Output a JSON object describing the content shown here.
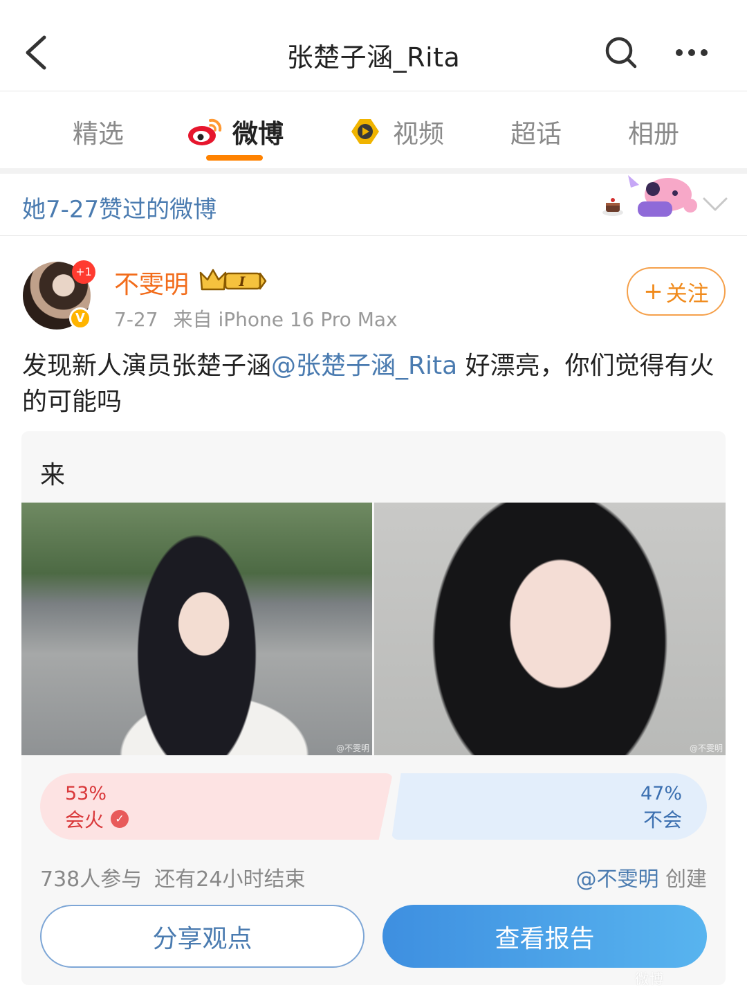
{
  "header": {
    "title": "张楚子涵_Rita",
    "back_icon": "chevron-left-icon",
    "search_icon": "search-icon",
    "more_icon": "more-dots-icon"
  },
  "tabs": [
    {
      "label": "精选",
      "active": false
    },
    {
      "label": "微博",
      "active": true,
      "icon": "weibo-logo-icon"
    },
    {
      "label": "视频",
      "active": false,
      "icon": "video-play-icon"
    },
    {
      "label": "超话",
      "active": false
    },
    {
      "label": "相册",
      "active": false
    }
  ],
  "accent_color": "#ff8200",
  "liked_banner": {
    "text": "她7-27赞过的微博",
    "expand_icon": "chevron-down-icon"
  },
  "post": {
    "author": {
      "name": "不雯明",
      "notification_badge": "+1",
      "verified_badge": "V",
      "level_badge": "I"
    },
    "date": "7-27",
    "source": "来自 iPhone 16 Pro Max",
    "follow_label": "关注",
    "follow_plus": "+",
    "text_before": "发现新人演员张楚子涵",
    "mention": "@张楚子涵_Rita",
    "text_after": " 好漂亮，你们觉得有火的可能吗"
  },
  "poll": {
    "title": "来",
    "photo_watermark_left": "@不雯明",
    "photo_watermark_right": "@不雯明",
    "options": [
      {
        "percent": "53%",
        "label": "会火",
        "selected": true,
        "fraction": 0.53,
        "color": "#d9383a"
      },
      {
        "percent": "47%",
        "label": "不会",
        "selected": false,
        "fraction": 0.47,
        "color": "#3b6fb0"
      }
    ],
    "participants": "738人参与",
    "remaining": "还有24小时结束",
    "creator_mention": "@不雯明",
    "creator_suffix": " 创建",
    "share_label": "分享观点",
    "report_label": "查看报告"
  },
  "corner_watermark": "微博"
}
